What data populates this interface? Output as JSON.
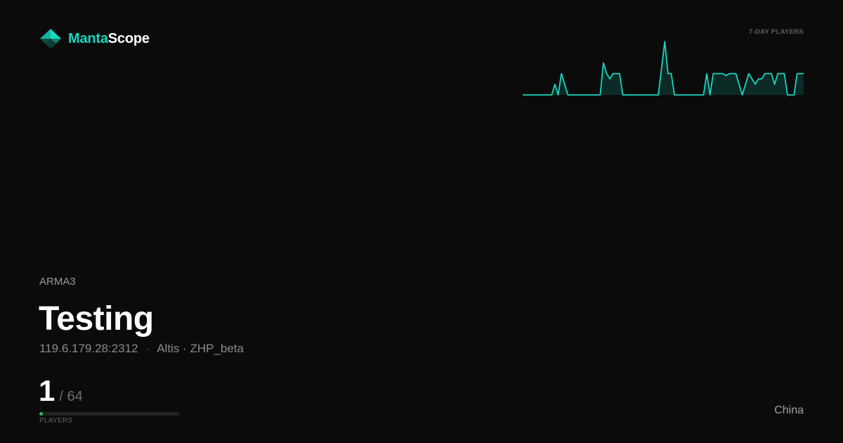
{
  "brand": {
    "name_accent": "Manta",
    "name_rest": "Scope",
    "logo_icon": "manta-diamond-icon",
    "accent_color": "#19d3bd"
  },
  "chart_data": {
    "type": "area",
    "title": "7-DAY PLAYERS",
    "line_color": "#19d3bd",
    "fill_color": "#0c2a26",
    "values": [
      0,
      0,
      0,
      0,
      0,
      0,
      0,
      0,
      0,
      0,
      1,
      0,
      2,
      1,
      0,
      0,
      0,
      0,
      0,
      0,
      0,
      0,
      0,
      0,
      0,
      3,
      2,
      1.5,
      2,
      2,
      2,
      0,
      0,
      0,
      0,
      0,
      0,
      0,
      0,
      0,
      0,
      0,
      0,
      2.5,
      5,
      2,
      2,
      0,
      0,
      0,
      0,
      0,
      0,
      0,
      0,
      0,
      0,
      2,
      0,
      2,
      2,
      2,
      2,
      1.8,
      2,
      2,
      2,
      1,
      0,
      1,
      2,
      1.5,
      1,
      1.5,
      1.5,
      2,
      2,
      2,
      1,
      2,
      2,
      2,
      0,
      0,
      0,
      2,
      2,
      2
    ],
    "ylim": [
      0,
      5.2
    ]
  },
  "server": {
    "game": "ARMA3",
    "name": "Testing",
    "address": "119.6.179.28:2312",
    "map_mission": "Altis · ZHP_beta",
    "separator": "·",
    "players": 1,
    "max_players": "/ 64",
    "players_fraction": 0.016,
    "players_label": "PLAYERS",
    "progress_color": "#22c55e",
    "country": "China"
  }
}
